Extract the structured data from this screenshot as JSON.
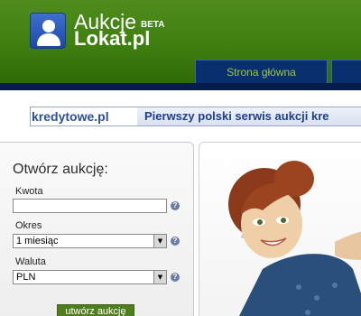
{
  "header": {
    "logo_top": "Aukcje",
    "logo_beta": "BETA",
    "logo_bottom": "Lokat.pl",
    "tabs": [
      {
        "label": "Strona główna"
      }
    ],
    "colors": {
      "header_green": "#3f7f10",
      "nav_blue": "#0a2f6e",
      "tab_text": "#9ec93b"
    }
  },
  "banner": {
    "logo_text": "kredytowe.pl",
    "text": "Pierwszy polski serwis aukcji kre"
  },
  "form": {
    "title": "Otwórz aukcję:",
    "amount_label": "Kwota",
    "amount_value": "",
    "period_label": "Okres",
    "period_value": "1 miesiąc",
    "currency_label": "Waluta",
    "currency_value": "PLN",
    "help_glyph": "?",
    "submit_label": "utwórz aukcję",
    "icons": [
      "user-icon",
      "help-icon",
      "dropdown-arrow-icon"
    ]
  }
}
